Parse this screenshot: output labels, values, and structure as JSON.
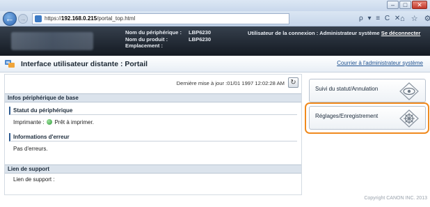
{
  "browser": {
    "url_prefix": "https://",
    "url_host": "192.168.0.215",
    "url_path": "/portal_top.html",
    "addr_tools": "ρ ▾ ≡ C ✕",
    "tools_icons": "⌂ ☆ ⚙",
    "win_minimize": "–",
    "win_restore": "□",
    "win_close": "✕",
    "back_glyph": "←",
    "fwd_glyph": "→"
  },
  "header": {
    "device_name_label": "Nom du périphérique :",
    "device_name_value": "LBP6230",
    "product_name_label": "Nom du produit :",
    "product_name_value": "LBP6230",
    "location_label": "Emplacement :",
    "location_value": "",
    "login_user_text": "Utilisateur de la connexion : Administrateur système",
    "logout_label": "Se déconnecter"
  },
  "title": {
    "text": "Interface utilisateur distante : Portail",
    "admin_link": "Courrier à l'administrateur système"
  },
  "main": {
    "last_update": "Dernière mise à jour :01/01 1997 12:02:28 AM",
    "refresh_glyph": "↻",
    "basic_info_heading": "Infos périphérique de base",
    "device_status_heading": "Statut du périphérique",
    "printer_label": "Imprimante :",
    "printer_status": "Prêt à imprimer.",
    "error_info_heading": "Informations d'erreur",
    "error_text": "Pas d'erreurs.",
    "support_heading": "Lien de support",
    "support_label": "Lien de support :"
  },
  "side": {
    "status_monitor_label": "Suivi du statut/Annulation",
    "settings_label": "Réglages/Enregistrement"
  },
  "colors": {
    "highlight": "#f08a1e",
    "header_bg": "#1e2630",
    "status_ok": "#2f9a3a"
  },
  "footer": {
    "copyright": "Copyright CANON INC. 2013"
  }
}
